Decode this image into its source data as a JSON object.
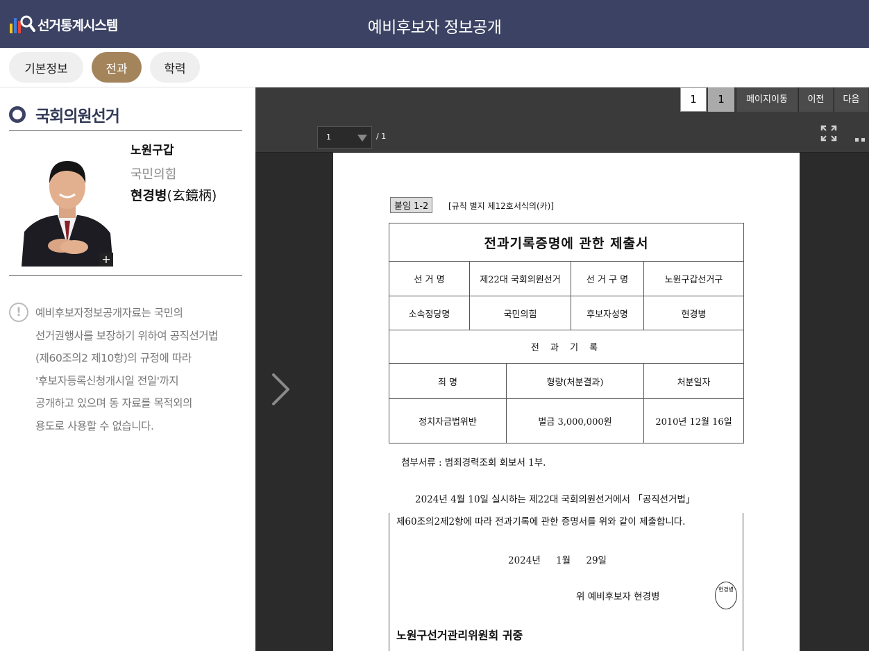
{
  "header": {
    "logo_text": "선거통계시스템",
    "title": "예비후보자 정보공개"
  },
  "tabs": [
    {
      "label": "기본정보",
      "active": false
    },
    {
      "label": "전과",
      "active": true
    },
    {
      "label": "학력",
      "active": false
    }
  ],
  "candidate": {
    "election_type": "국회의원선거",
    "district": "노원구갑",
    "party": "국민의힘",
    "name": "현경병",
    "name_hanja": "(玄鏡柄)",
    "photo_expand_label": "+"
  },
  "notice": {
    "icon_label": "!",
    "lines": [
      "예비후보자정보공개자료는 국민의",
      "선거권행사를 보장하기 위하여 공직선거법",
      "(제60조의2 제10항)의 규정에 따라",
      "'후보자등록신청개시일 전일'까지",
      "공개하고 있으며 동 자료를 목적외의",
      "용도로 사용할 수 없습니다."
    ]
  },
  "viewer": {
    "current_page": "1",
    "total_pages": "1",
    "go_label": "페이지이동",
    "prev_label": "이전",
    "next_label": "다음",
    "select_value": "1",
    "of_label": "/ 1"
  },
  "document": {
    "badge": "붙임 1-2",
    "rule_ref": "[규칙 별지 제12호서식의(카)]",
    "title": "전과기록증명에 관한 제출서",
    "row1": [
      "선 거 명",
      "제22대 국회의원선거",
      "선 거 구 명",
      "노원구갑선거구"
    ],
    "row2": [
      "소속정당명",
      "국민의힘",
      "후보자성명",
      "현경병"
    ],
    "section": "전 과 기 록",
    "table_headers": [
      "죄 명",
      "형량(처분결과)",
      "처분일자"
    ],
    "record": [
      "정치자금법위반",
      "벌금 3,000,000원",
      "2010년 12월 16일"
    ],
    "attachment": "첨부서류 : 범죄경력조회 회보서 1부.",
    "para1": "2024년 4월 10일 실시하는 제22대 국회의원선거에서 「공직선거법」",
    "para2": "제60조의2제2항에 따라 전과기록에 관한 증명서를 위와 같이 제출합니다.",
    "date": "2024년 1월 29일",
    "signature": "위      예비후보자   현경병",
    "seal_text": "현경병",
    "addressee": "노원구선거관리위원회 귀중"
  }
}
